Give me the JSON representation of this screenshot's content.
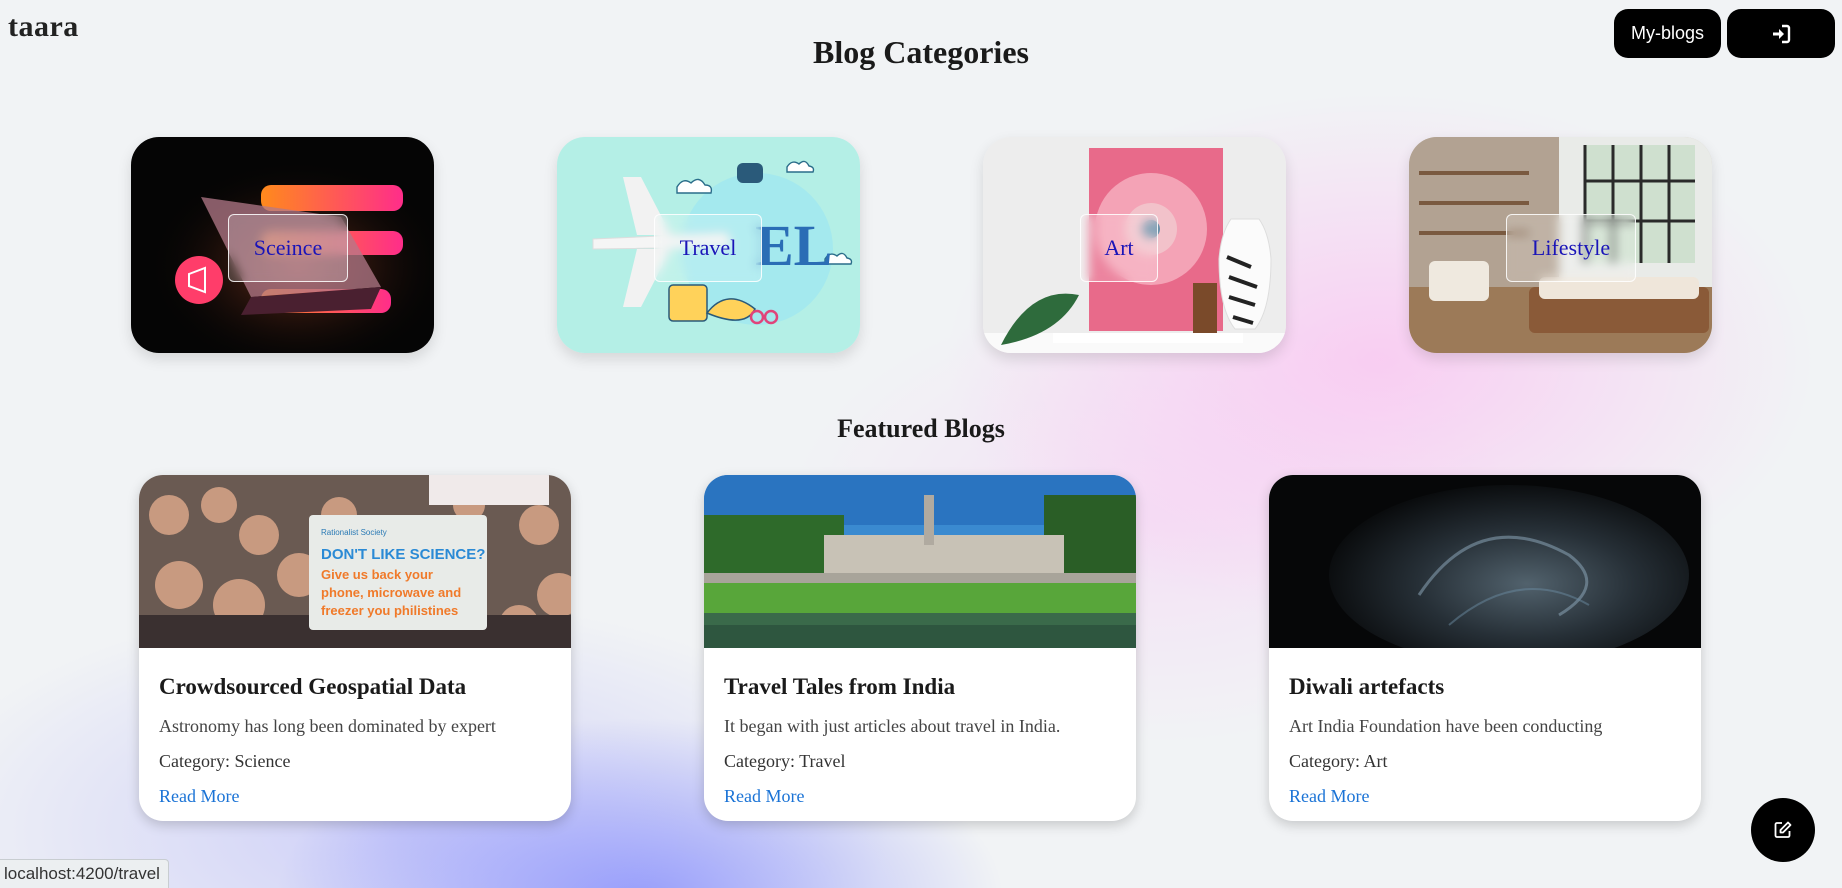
{
  "brand": "taara",
  "header": {
    "title": "Blog Categories",
    "my_blogs_label": "My-blogs",
    "login_icon": "sign-in-icon"
  },
  "categories": [
    {
      "label": "Sceince"
    },
    {
      "label": "Travel"
    },
    {
      "label": "Art"
    },
    {
      "label": "Lifestyle"
    }
  ],
  "featured": {
    "title": "Featured Blogs",
    "blogs": [
      {
        "title": "Crowdsourced Geospatial Data",
        "excerpt": "Astronomy has long been dominated by expert",
        "category": "Category: Science",
        "link": "Read More",
        "image_sign_heading": "DON'T LIKE SCIENCE?",
        "image_sign_body": "Give us back your phone, microwave and freezer you philistines"
      },
      {
        "title": "Travel Tales from India",
        "excerpt": "It began with just articles about travel in India.",
        "category": "Category: Travel",
        "link": "Read More"
      },
      {
        "title": "Diwali artefacts",
        "excerpt": "Art India Foundation have been conducting",
        "category": "Category: Art",
        "link": "Read More"
      }
    ]
  },
  "fab_icon": "edit-icon",
  "status_url": "localhost:4200/travel",
  "colors": {
    "category_label": "#1a14b8",
    "link": "#1a73d6",
    "button_bg": "#000000"
  }
}
